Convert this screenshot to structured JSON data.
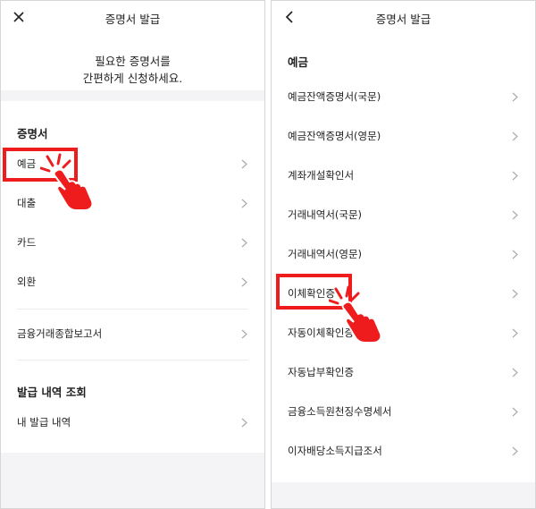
{
  "left": {
    "title": "증명서 발급",
    "close_icon": "close-icon",
    "intro_line1": "필요한 증명서를",
    "intro_line2": "간편하게 신청하세요.",
    "section1_title": "증명서",
    "items": [
      {
        "label": "예금"
      },
      {
        "label": "대출"
      },
      {
        "label": "카드"
      },
      {
        "label": "외환"
      },
      {
        "label": "금융거래종합보고서"
      }
    ],
    "section2_title": "발급 내역 조회",
    "history_item": "내 발급 내역"
  },
  "right": {
    "title": "증명서 발급",
    "back_icon": "back-arrow-icon",
    "section_title": "예금",
    "items": [
      {
        "label": "예금잔액증명서(국문)"
      },
      {
        "label": "예금잔액증명서(영문)"
      },
      {
        "label": "계좌개설확인서"
      },
      {
        "label": "거래내역서(국문)"
      },
      {
        "label": "거래내역서(영문)"
      },
      {
        "label": "이체확인증"
      },
      {
        "label": "자동이체확인증"
      },
      {
        "label": "자동납부확인증"
      },
      {
        "label": "금융소득원천징수명세서"
      },
      {
        "label": "이자배당소득지급조서"
      }
    ]
  },
  "colors": {
    "highlight": "#ee1c1c",
    "band": "#f4f4f6",
    "chevron": "#aaaaaa"
  }
}
